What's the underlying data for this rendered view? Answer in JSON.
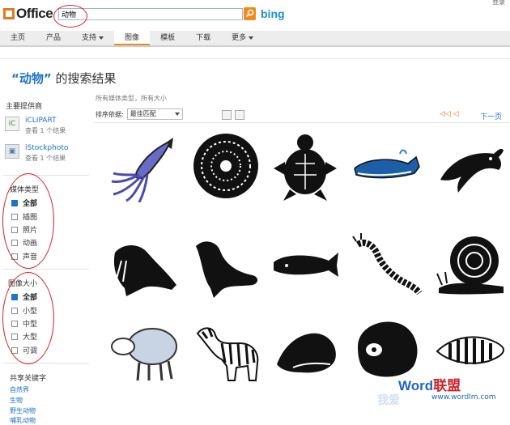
{
  "header": {
    "logo_text": "Office",
    "search_value": "动物",
    "search_provider": "bing",
    "top_right": "登录"
  },
  "nav": {
    "items": [
      {
        "label": "主页",
        "active": false,
        "dropdown": false
      },
      {
        "label": "产品",
        "active": false,
        "dropdown": false
      },
      {
        "label": "支持",
        "active": false,
        "dropdown": true
      },
      {
        "label": "图像",
        "active": true,
        "dropdown": false
      },
      {
        "label": "模板",
        "active": false,
        "dropdown": false
      },
      {
        "label": "下载",
        "active": false,
        "dropdown": false
      },
      {
        "label": "更多",
        "active": false,
        "dropdown": true
      }
    ]
  },
  "page": {
    "query_quoted": "“动物”",
    "title_suffix": " 的搜索结果"
  },
  "sidebar": {
    "providers_title": "主要提供商",
    "providers": [
      {
        "name": "iCLIPART",
        "count": "查看 1 个结果",
        "icon": "iclipart-icon"
      },
      {
        "name": "iStockphoto",
        "count": "查看 1 个结果",
        "icon": "istockphoto-icon"
      }
    ],
    "media_title": "媒体类型",
    "media_types": [
      {
        "label": "全部",
        "checked": true
      },
      {
        "label": "插图",
        "checked": false
      },
      {
        "label": "照片",
        "checked": false
      },
      {
        "label": "动画",
        "checked": false
      },
      {
        "label": "声音",
        "checked": false
      }
    ],
    "size_title": "图像大小",
    "sizes": [
      {
        "label": "全部",
        "checked": true
      },
      {
        "label": "小型",
        "checked": false
      },
      {
        "label": "中型",
        "checked": false
      },
      {
        "label": "大型",
        "checked": false
      },
      {
        "label": "可调",
        "checked": false
      }
    ],
    "shared_title": "共享关键字",
    "shared_keywords": [
      "自然界",
      "生物",
      "野生动物",
      "哺乳动物"
    ]
  },
  "results": {
    "filter_summary": "所有媒体类型，所有大小",
    "sort_label": "排序依据:",
    "sort_value": "最佳匹配",
    "next_label": "下一页",
    "items": [
      {
        "name": "squid-clipart"
      },
      {
        "name": "ammonite-shell-clipart"
      },
      {
        "name": "turtle-clipart"
      },
      {
        "name": "whale-clipart"
      },
      {
        "name": "dolphin-clipart"
      },
      {
        "name": "walrus-clipart"
      },
      {
        "name": "sea-lion-clipart"
      },
      {
        "name": "sperm-whale-clipart"
      },
      {
        "name": "centipede-clipart"
      },
      {
        "name": "snail-clipart"
      },
      {
        "name": "sheep-clipart"
      },
      {
        "name": "zebra-clipart"
      },
      {
        "name": "conch-shell-clipart"
      },
      {
        "name": "abalone-shell-clipart"
      },
      {
        "name": "cone-shell-clipart"
      }
    ]
  },
  "watermark": {
    "brand": "Word",
    "brand_cn": "联盟",
    "url": "www.wordlm.com",
    "slogan": "我爱"
  },
  "colors": {
    "accent": "#f08a1c",
    "link": "#1e6ec8",
    "annotation": "#d4202a"
  }
}
